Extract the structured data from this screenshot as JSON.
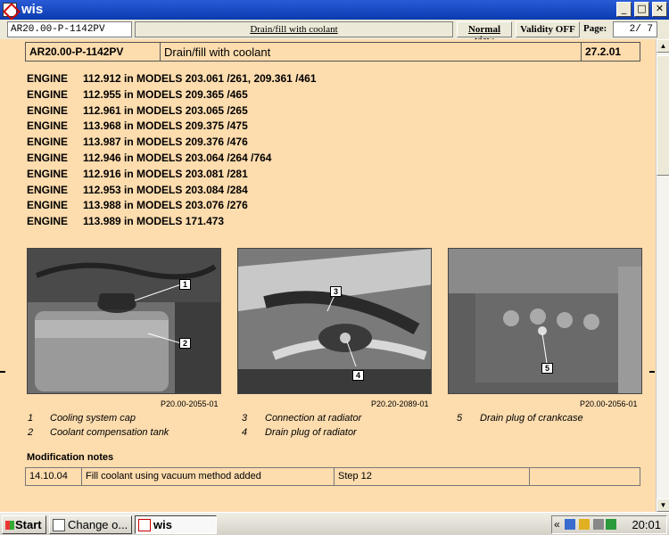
{
  "window": {
    "title": "wis",
    "buttons": {
      "minimize": "_",
      "maximize": "□",
      "close": "✕"
    }
  },
  "toolbar": {
    "doc_id": "AR20.00-P-1142PV",
    "doc_title": "Drain/fill with coolant",
    "normal_view": "Normal view",
    "validity": "Validity OFF",
    "page_label": "Page:",
    "page_value": "2/ 7"
  },
  "header": {
    "doc_id": "AR20.00-P-1142PV",
    "title": "Drain/fill with coolant",
    "date": "27.2.01"
  },
  "engines": [
    {
      "label": "ENGINE",
      "text": "112.912 in MODELS 203.061 /261, 209.361 /461"
    },
    {
      "label": "ENGINE",
      "text": "112.955 in MODELS 209.365 /465"
    },
    {
      "label": "ENGINE",
      "text": "112.961 in MODELS 203.065 /265"
    },
    {
      "label": "ENGINE",
      "text": "113.968 in MODELS 209.375 /475"
    },
    {
      "label": "ENGINE",
      "text": "113.987 in MODELS 209.376 /476"
    },
    {
      "label": "ENGINE",
      "text": "112.946 in MODELS 203.064 /264 /764"
    },
    {
      "label": "ENGINE",
      "text": "112.916 in MODELS 203.081 /281"
    },
    {
      "label": "ENGINE",
      "text": "112.953 in MODELS 203.084 /284"
    },
    {
      "label": "ENGINE",
      "text": "113.988 in MODELS 203.076 /276"
    },
    {
      "label": "ENGINE",
      "text": "113.989 in MODELS 171.473"
    }
  ],
  "figures": [
    {
      "code": "P20.00-2055-01",
      "callouts": [
        "1",
        "2"
      ]
    },
    {
      "code": "P20.20-2089-01",
      "callouts": [
        "3",
        "4"
      ]
    },
    {
      "code": "P20.00-2056-01",
      "callouts": [
        "5"
      ]
    }
  ],
  "legend": [
    {
      "num": "1",
      "text": "Cooling system cap"
    },
    {
      "num": "2",
      "text": "Coolant compensation tank"
    },
    {
      "num": "3",
      "text": "Connection at radiator"
    },
    {
      "num": "4",
      "text": "Drain plug of radiator"
    },
    {
      "num": "5",
      "text": "Drain plug of crankcase"
    }
  ],
  "modification": {
    "title": "Modification notes",
    "rows": [
      {
        "date": "14.10.04",
        "text": "Fill coolant using vacuum method added",
        "step": "Step 12",
        "extra": ""
      }
    ]
  },
  "taskbar": {
    "start": "Start",
    "tasks": [
      {
        "label": "Change o..."
      },
      {
        "label": "wis"
      }
    ],
    "chevron": "«",
    "clock": "20:01"
  },
  "colors": {
    "content_bg": "#fddcae",
    "titlebar": "#0a3bb0"
  }
}
